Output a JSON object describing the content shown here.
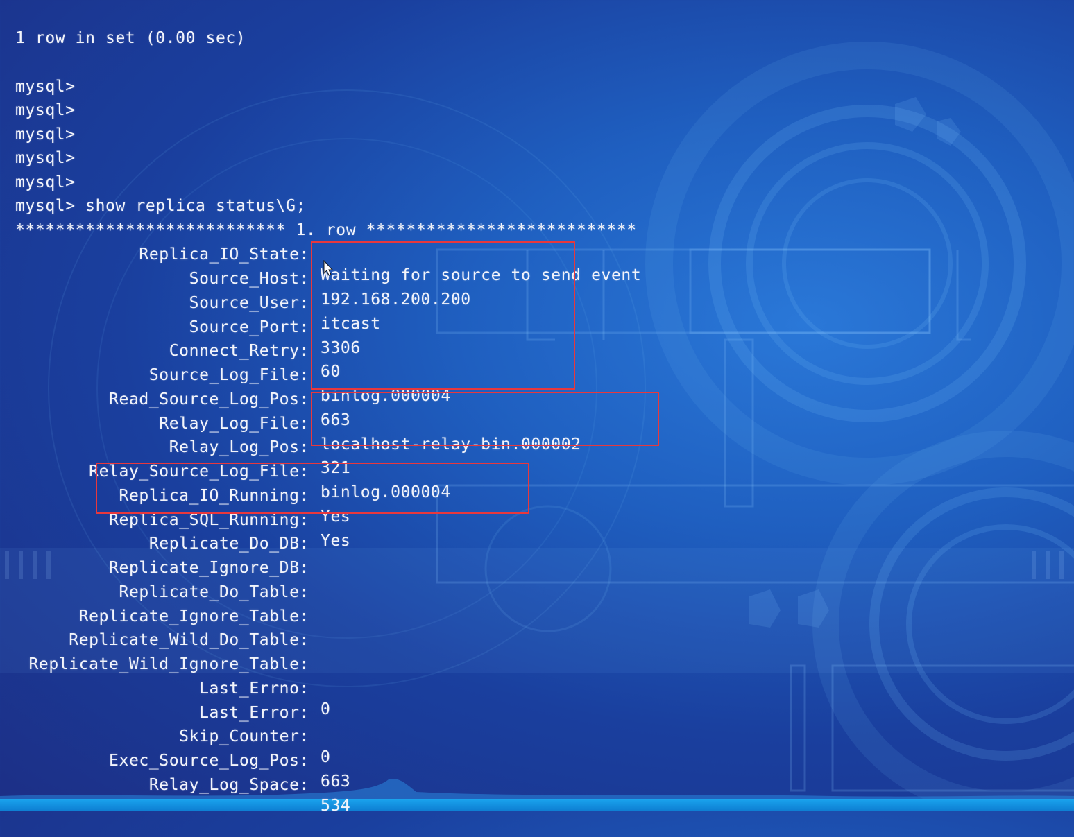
{
  "colors": {
    "text": "#f2f4fb",
    "highlight_box": "#e8383d",
    "background_deep": "#1c2f86",
    "background_light": "#2a78d8"
  },
  "terminal": {
    "result_summary": "1 row in set (0.00 sec)",
    "prompts": [
      "mysql>",
      "mysql>",
      "mysql>",
      "mysql>",
      "mysql>"
    ],
    "command_line": "mysql> show replica status\\G;",
    "row_header": "*************************** 1. row ***************************",
    "fields": [
      {
        "key": "Replica_IO_State:",
        "value": "Waiting for source to send event"
      },
      {
        "key": "Source_Host:",
        "value": "192.168.200.200"
      },
      {
        "key": "Source_User:",
        "value": "itcast"
      },
      {
        "key": "Source_Port:",
        "value": "3306"
      },
      {
        "key": "Connect_Retry:",
        "value": "60"
      },
      {
        "key": "Source_Log_File:",
        "value": "binlog.000004"
      },
      {
        "key": "Read_Source_Log_Pos:",
        "value": "663"
      },
      {
        "key": "Relay_Log_File:",
        "value": "localhost-relay-bin.000002"
      },
      {
        "key": "Relay_Log_Pos:",
        "value": "321"
      },
      {
        "key": "Relay_Source_Log_File:",
        "value": "binlog.000004"
      },
      {
        "key": "Replica_IO_Running:",
        "value": "Yes"
      },
      {
        "key": "Replica_SQL_Running:",
        "value": "Yes"
      },
      {
        "key": "Replicate_Do_DB:",
        "value": ""
      },
      {
        "key": "Replicate_Ignore_DB:",
        "value": ""
      },
      {
        "key": "Replicate_Do_Table:",
        "value": ""
      },
      {
        "key": "Replicate_Ignore_Table:",
        "value": ""
      },
      {
        "key": "Replicate_Wild_Do_Table:",
        "value": ""
      },
      {
        "key": "Replicate_Wild_Ignore_Table:",
        "value": ""
      },
      {
        "key": "Last_Errno:",
        "value": "0"
      },
      {
        "key": "Last_Error:",
        "value": ""
      },
      {
        "key": "Skip_Counter:",
        "value": "0"
      },
      {
        "key": "Exec_Source_Log_Pos:",
        "value": "663"
      },
      {
        "key": "Relay_Log_Space:",
        "value": "534"
      }
    ]
  }
}
